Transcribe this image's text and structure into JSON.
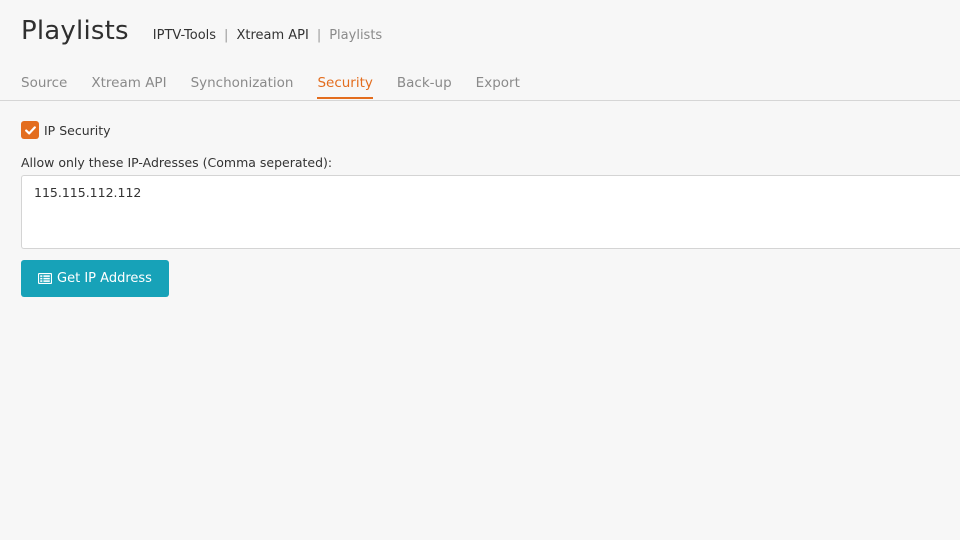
{
  "page_title": "Playlists",
  "breadcrumb": {
    "items": [
      "IPTV-Tools",
      "Xtream API",
      "Playlists"
    ],
    "separator": "|"
  },
  "tabs": [
    {
      "label": "Source",
      "active": false
    },
    {
      "label": "Xtream API",
      "active": false
    },
    {
      "label": "Synchonization",
      "active": false
    },
    {
      "label": "Security",
      "active": true
    },
    {
      "label": "Back-up",
      "active": false
    },
    {
      "label": "Export",
      "active": false
    }
  ],
  "security": {
    "ip_security_label": "IP Security",
    "ip_security_checked": true,
    "allowed_ips_label": "Allow only these IP-Adresses (Comma seperated):",
    "allowed_ips_value": "115.115.112.112",
    "get_ip_button_label": "Get IP Address",
    "get_ip_button_icon": "list-icon"
  },
  "colors": {
    "accent": "#e36d1e",
    "button": "#17a2b8",
    "background": "#f7f7f7"
  }
}
